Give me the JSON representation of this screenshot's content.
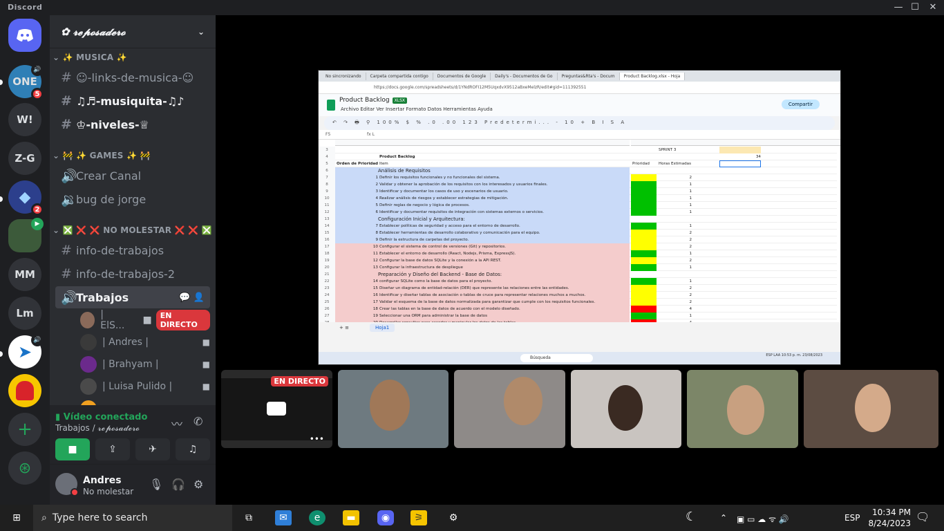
{
  "app": {
    "brand": "Discord",
    "minimize": "—",
    "maximize": "☐",
    "close": "✕"
  },
  "servers": [
    {
      "label": "ONE",
      "badge": "5"
    },
    {
      "label": "W!"
    },
    {
      "label": "Z-G"
    },
    {
      "label": "",
      "badge": "2"
    },
    {
      "label": ""
    },
    {
      "label": "MM"
    },
    {
      "label": "Lm"
    },
    {
      "label": ""
    },
    {
      "label": ""
    },
    {
      "label": "+"
    },
    {
      "label": "⊛"
    }
  ],
  "guild": {
    "name": "✿ 𝓻𝓮𝓹𝓸𝓼𝓪𝓭𝓮𝓻𝓸",
    "chevron": "⌄"
  },
  "categories": {
    "musica": "✨ MUSICA ✨",
    "games": "🚧 ✨ GAMES ✨ 🚧",
    "nomolestar": "❎ ❌ ❌ NO MOLESTAR ❌ ❌ ❎"
  },
  "channels": {
    "links": "☺-links-de-musica-☺",
    "musiquita": "♫♬-musiquita-♫♪",
    "niveles": "♔-niveles-♕",
    "crear": "Crear Canal",
    "bug": "bug de jorge",
    "info": "info-de-trabajos",
    "info2": "info-de-trabajos-2",
    "trabajos": "Trabajos"
  },
  "voiceusers": [
    {
      "name": "| ElS...",
      "live": "EN DIRECTO"
    },
    {
      "name": "| Andres |"
    },
    {
      "name": "| Brahyam |"
    },
    {
      "name": "| Luisa Pulido |"
    }
  ],
  "voice": {
    "status": "Vídeo conectado",
    "location": "Trabajos / 𝓻𝓮𝓹𝓸𝓼𝓪𝓭𝓮𝓻𝓸"
  },
  "user": {
    "name": "Andres",
    "status": "No molestar"
  },
  "screen": {
    "tabs": [
      "No sincronizando",
      "Carpeta compartida contigo",
      "Documentos de Google",
      "Daily's - Documentos de Go",
      "Preguntas&Rta's - Docum",
      "Product Backlog.xlsx - Hoja"
    ],
    "url": "https://docs.google.com/spreadsheets/d/1YNdROFI12M5UqxdvX9512aBxeMelzR/edit#gid=111392551",
    "title": "Product Backlog",
    "ext": "XLSX",
    "menus": "Archivo   Editar   Ver   Insertar   Formato   Datos   Herramientas   Ayuda",
    "share": "Compartir",
    "toolbar": "↶ ↷ 🖶 ⚲ 100% $ % .0 .00 123 Predetermi... - 10 + B I S A",
    "cellref": "F5",
    "formula": "fx  L",
    "sheet_title": "Product Backlog",
    "sprint": "SPRINT 3",
    "sprint_value": "34",
    "col_orden": "Orden de Prioridad",
    "col_item": "Item",
    "col_prio": "Prioridad",
    "col_horas": "Horas Estimadas",
    "sheet_tab": "Hoja1",
    "search": "Búsqueda",
    "lang": "ESP LAA",
    "clock": "10:53 p. m. 23/08/2023"
  },
  "rows": [
    {
      "rn": "6",
      "num": "",
      "text": "Análisis de Requisitos",
      "hrs": "",
      "color": "blue",
      "prio": "none"
    },
    {
      "rn": "7",
      "num": "1",
      "text": "Definir los requisitos funcionales y no funcionales del sistema.",
      "hrs": "2",
      "color": "blue",
      "prio": "yellow"
    },
    {
      "rn": "8",
      "num": "2",
      "text": "Validar y obtener la aprobación de los requisitos con los interesados y usuarios finales.",
      "hrs": "1",
      "color": "blue",
      "prio": "green"
    },
    {
      "rn": "9",
      "num": "3",
      "text": "Identificar y documentar los casos de uso y escenarios de usuario.",
      "hrs": "1",
      "color": "blue",
      "prio": "green"
    },
    {
      "rn": "10",
      "num": "4",
      "text": "Realizar análisis de riesgos y establecer estrategias de mitigación.",
      "hrs": "1",
      "color": "blue",
      "prio": "green"
    },
    {
      "rn": "11",
      "num": "5",
      "text": "Definir reglas de negocio y lógica de procesos.",
      "hrs": "1",
      "color": "blue",
      "prio": "green"
    },
    {
      "rn": "12",
      "num": "6",
      "text": "Identificar y documentar requisitos de integración con sistemas externos o servicios.",
      "hrs": "1",
      "color": "blue",
      "prio": "green"
    },
    {
      "rn": "13",
      "num": "",
      "text": "Configuración Inicial y Arquitectura:",
      "hrs": "",
      "color": "blue",
      "prio": "none"
    },
    {
      "rn": "14",
      "num": "7",
      "text": "Establecer políticas de seguridad y acceso para el entorno de desarrollo.",
      "hrs": "1",
      "color": "blue",
      "prio": "green"
    },
    {
      "rn": "15",
      "num": "8",
      "text": "Establecer herramientas de desarrollo colaborativo y comunicación para el equipo.",
      "hrs": "2",
      "color": "blue",
      "prio": "yellow"
    },
    {
      "rn": "16",
      "num": "9",
      "text": "Definir la estructura de carpetas del proyecto.",
      "hrs": "2",
      "color": "blue",
      "prio": "yellow"
    },
    {
      "rn": "17",
      "num": "10",
      "text": "Configurar el sistema de control de versiones (Git) y repositorios.",
      "hrs": "2",
      "color": "pink",
      "prio": "yellow"
    },
    {
      "rn": "18",
      "num": "11",
      "text": "Establecer el entorno de desarrollo (React, Nodejs, Prisma, ExpressJS).",
      "hrs": "1",
      "color": "pink",
      "prio": "green"
    },
    {
      "rn": "19",
      "num": "12",
      "text": "Configurar la base de datos SQLite y la conexión a la API REST.",
      "hrs": "2",
      "color": "pink",
      "prio": "yellow"
    },
    {
      "rn": "20",
      "num": "13",
      "text": "Configurar la infraestructura de despliegue",
      "hrs": "1",
      "color": "pink",
      "prio": "green"
    },
    {
      "rn": "21",
      "num": "",
      "text": "Preparación y Diseño del Backend - Base de Datos:",
      "hrs": "",
      "color": "pink",
      "prio": "none"
    },
    {
      "rn": "22",
      "num": "14",
      "text": "configurar SQLite como la base de datos para el proyecto.",
      "hrs": "1",
      "color": "pink",
      "prio": "green"
    },
    {
      "rn": "23",
      "num": "15",
      "text": "Diseñar un diagrama de entidad-relación (DER) que represente las relaciones entre las entidades.",
      "hrs": "2",
      "color": "pink",
      "prio": "yellow"
    },
    {
      "rn": "24",
      "num": "16",
      "text": "Identificar y diseñar tablas de asociación o tablas de cruce para representar relaciones muchos a muchos.",
      "hrs": "2",
      "color": "pink",
      "prio": "yellow"
    },
    {
      "rn": "25",
      "num": "17",
      "text": "Validar el esquema de la base de datos normalizada para garantizar que cumple con los requisitos funcionales.",
      "hrs": "2",
      "color": "pink",
      "prio": "yellow"
    },
    {
      "rn": "26",
      "num": "18",
      "text": "Crear las tablas en la base de datos de acuerdo con el modelo diseñado.",
      "hrs": "4",
      "color": "pink",
      "prio": "red"
    },
    {
      "rn": "27",
      "num": "19",
      "text": "Seleccionar una ORM para administrar la base de datos",
      "hrs": "1",
      "color": "pink",
      "prio": "green"
    },
    {
      "rn": "28",
      "num": "20",
      "text": "Desarrollar consultas para acceder y manipular los datos de las tablas.",
      "hrs": "4",
      "color": "pink",
      "prio": "red"
    }
  ],
  "tiles": {
    "live": "EN DIRECTO",
    "more": "•••"
  },
  "taskbar": {
    "search": "Type here to search",
    "lang": "ESP",
    "time": "10:34 PM",
    "date": "8/24/2023"
  },
  "colors": {
    "green": "#00c000",
    "yellow": "#ffff00",
    "red": "#ff0000",
    "blue": "#c9daf8",
    "pink": "#f4cccc"
  }
}
